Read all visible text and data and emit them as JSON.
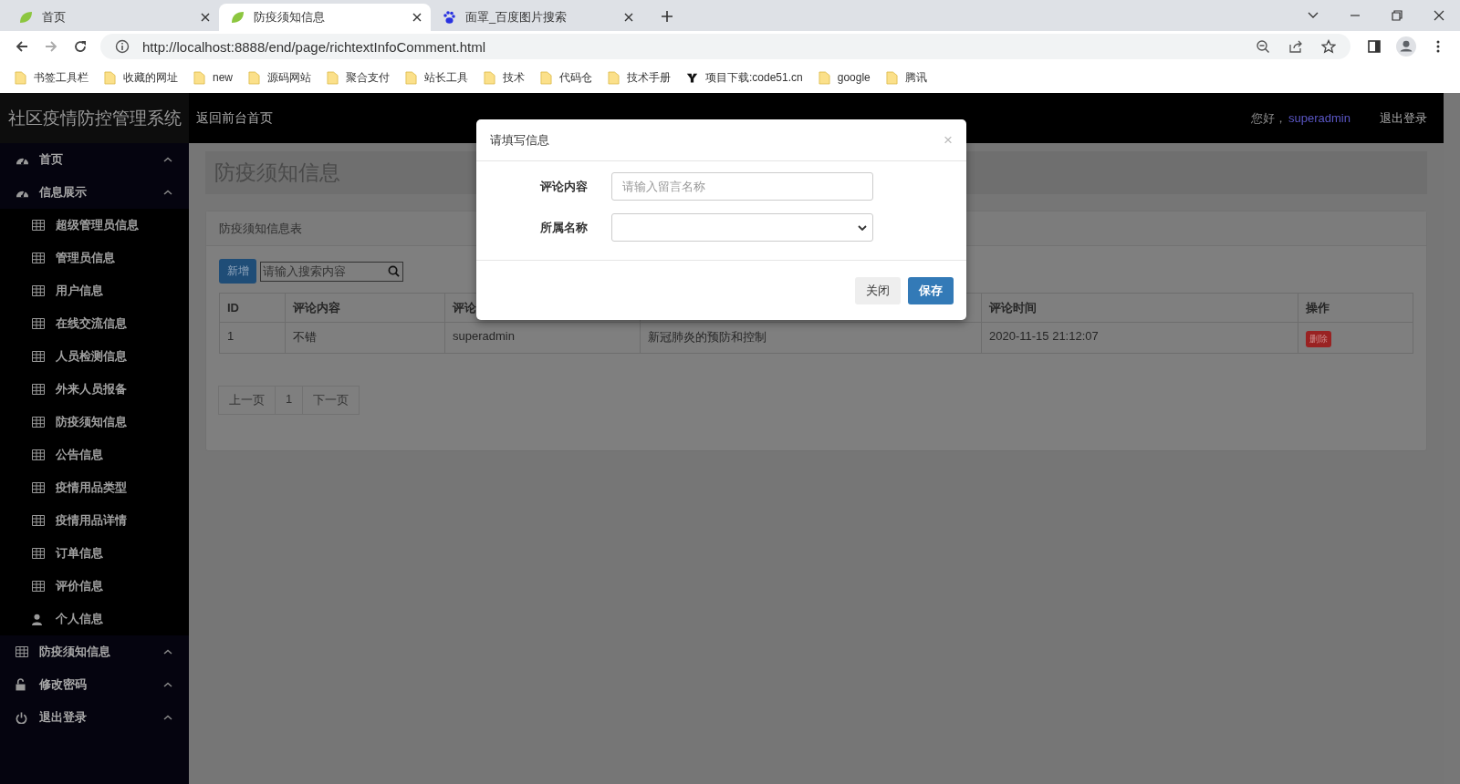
{
  "browser": {
    "tabs": [
      {
        "title": "首页",
        "kind": "leaf",
        "selected": false
      },
      {
        "title": "防疫须知信息",
        "kind": "leaf",
        "selected": true
      },
      {
        "title": "面罩_百度图片搜索",
        "kind": "paw",
        "selected": false
      }
    ],
    "url": "http://localhost:8888/end/page/richtextInfoComment.html",
    "bookmarks": [
      {
        "label": "书签工具栏",
        "kind": "folder"
      },
      {
        "label": "收藏的网址",
        "kind": "folder"
      },
      {
        "label": "new",
        "kind": "folder"
      },
      {
        "label": "源码网站",
        "kind": "folder"
      },
      {
        "label": "聚合支付",
        "kind": "folder"
      },
      {
        "label": "站长工具",
        "kind": "folder"
      },
      {
        "label": "技术",
        "kind": "folder"
      },
      {
        "label": "代码仓",
        "kind": "folder"
      },
      {
        "label": "技术手册",
        "kind": "folder"
      },
      {
        "label": "项目下载:code51.cn",
        "kind": "site"
      },
      {
        "label": "google",
        "kind": "folder"
      },
      {
        "label": "腾讯",
        "kind": "folder"
      }
    ]
  },
  "navbar": {
    "title": "社区疫情防控管理系统",
    "home_link": "返回前台首页",
    "greeting": "您好，",
    "user": "superadmin",
    "logout": "退出登录"
  },
  "sidebar": {
    "items": [
      {
        "label": "首页",
        "kind": "dashboard"
      },
      {
        "label": "信息展示",
        "kind": "dashboard",
        "children": [
          {
            "label": "超级管理员信息",
            "kind": "table"
          },
          {
            "label": "管理员信息",
            "kind": "table"
          },
          {
            "label": "用户信息",
            "kind": "table"
          },
          {
            "label": "在线交流信息",
            "kind": "table"
          },
          {
            "label": "人员检测信息",
            "kind": "table"
          },
          {
            "label": "外来人员报备",
            "kind": "table"
          },
          {
            "label": "防疫须知信息",
            "kind": "table"
          },
          {
            "label": "公告信息",
            "kind": "table"
          },
          {
            "label": "疫情用品类型",
            "kind": "table"
          },
          {
            "label": "疫情用品详情",
            "kind": "table"
          },
          {
            "label": "订单信息",
            "kind": "table"
          },
          {
            "label": "评价信息",
            "kind": "table"
          },
          {
            "label": "个人信息",
            "kind": "user"
          }
        ]
      },
      {
        "label": "防疫须知信息",
        "kind": "table"
      },
      {
        "label": "修改密码",
        "kind": "lock"
      },
      {
        "label": "退出登录",
        "kind": "power"
      }
    ]
  },
  "page": {
    "heading": "防疫须知信息",
    "card": {
      "title": "防疫须知信息表",
      "add_button": "新增",
      "search": {
        "placeholder": "请输入搜索内容"
      },
      "table": {
        "columns": [
          "ID",
          "评论内容",
          "评论",
          null,
          "评论时间",
          "操作"
        ],
        "rows": [
          {
            "cells": [
              "1",
              "不错",
              "superadmin",
              "新冠肺炎的预防和控制",
              "2020-11-15 21:12:07"
            ],
            "action": "删除"
          }
        ]
      },
      "pagination": {
        "prev": "上一页",
        "pages": [
          {
            "label": "1"
          }
        ],
        "next": "下一页"
      }
    }
  },
  "dialog": {
    "title": "请填写信息",
    "close": "×",
    "fields": [
      {
        "label": "评论内容",
        "kind": "text",
        "placeholder": "请输入留言名称"
      },
      {
        "label": "所属名称",
        "kind": "select"
      }
    ],
    "buttons": [
      {
        "label": "关闭",
        "kind": "default"
      },
      {
        "label": "保存",
        "kind": "primary"
      }
    ]
  }
}
